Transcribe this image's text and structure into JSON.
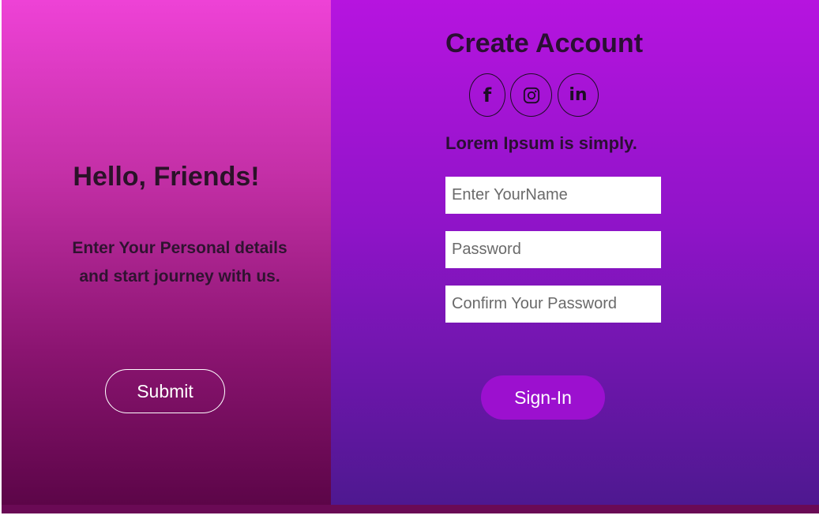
{
  "left": {
    "title": "Hello, Friends!",
    "line1": "Enter Your Personal details",
    "line2": "and start journey with us.",
    "submit_label": "Submit"
  },
  "right": {
    "title": "Create Account",
    "social": [
      {
        "name": "facebook-icon",
        "glyph": "f"
      },
      {
        "name": "instagram-icon",
        "glyph": ""
      },
      {
        "name": "linkedin-icon",
        "glyph": "in"
      }
    ],
    "subtext": "Lorem Ipsum is simply.",
    "fields": {
      "name_placeholder": "Enter YourName",
      "password_placeholder": "Password",
      "confirm_placeholder": "Confirm Your Password"
    },
    "signin_label": "Sign-In"
  },
  "colors": {
    "left_gradient_top": "#ee42d6",
    "left_gradient_bottom": "#5c0548",
    "right_gradient_top": "#b614df",
    "right_gradient_bottom": "#4e1890",
    "signin_button": "#9c10cf"
  }
}
